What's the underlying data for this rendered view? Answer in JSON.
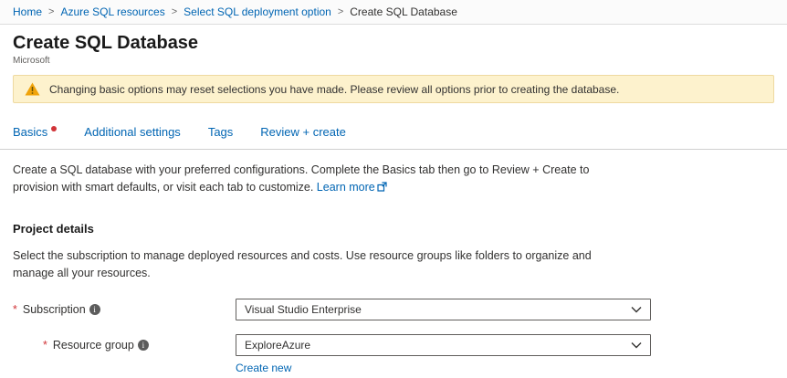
{
  "breadcrumb": {
    "separator": ">",
    "items": [
      {
        "label": "Home"
      },
      {
        "label": "Azure SQL resources"
      },
      {
        "label": "Select SQL deployment option"
      },
      {
        "label": "Create SQL Database"
      }
    ]
  },
  "header": {
    "title": "Create SQL Database",
    "publisher": "Microsoft"
  },
  "warning": {
    "text": "Changing basic options may reset selections you have made. Please review all options prior to creating the database."
  },
  "tabs": [
    {
      "label": "Basics",
      "has_error_dot": true
    },
    {
      "label": "Additional settings"
    },
    {
      "label": "Tags"
    },
    {
      "label": "Review + create"
    }
  ],
  "intro": {
    "text": "Create a SQL database with your preferred configurations. Complete the Basics tab then go to Review + Create to provision with smart defaults, or visit each tab to customize.",
    "learn_more": "Learn more"
  },
  "project_details": {
    "heading": "Project details",
    "description": "Select the subscription to manage deployed resources and costs. Use resource groups like folders to organize and manage all your resources."
  },
  "form": {
    "subscription": {
      "required": "*",
      "label": "Subscription",
      "value": "Visual Studio Enterprise"
    },
    "resource_group": {
      "required": "*",
      "label": "Resource group",
      "value": "ExploreAzure",
      "create_new": "Create new"
    }
  },
  "colors": {
    "link_blue": "#0065b3",
    "warning_bg": "#fdf2cd",
    "warning_border": "#eed9a0",
    "error_red": "#d13438"
  }
}
